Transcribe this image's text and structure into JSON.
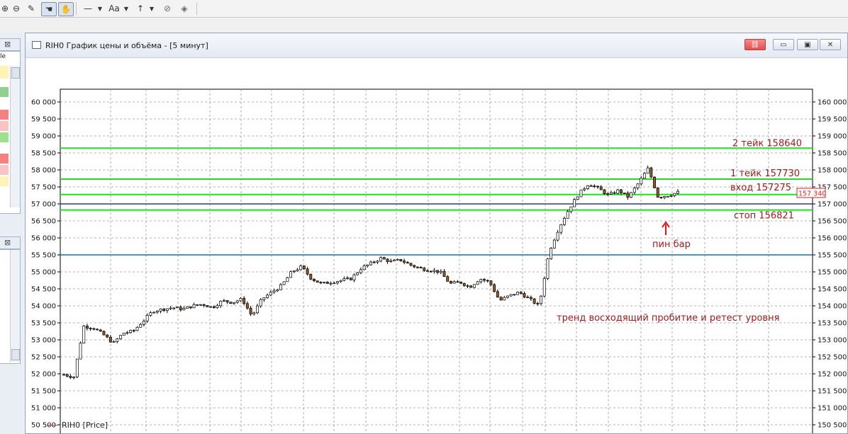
{
  "toolbar": {
    "font_label": "Aa"
  },
  "window": {
    "title": "RIH0 График цены и объёма - [5 минут]",
    "legend": "RIH0 [Price]"
  },
  "left_panel": {
    "label": "le"
  },
  "axis": {
    "left_ticks": [
      "60 000",
      "59 500",
      "59 000",
      "58 500",
      "58 000",
      "57 500",
      "57 000",
      "56 500",
      "56 000",
      "55 500",
      "55 000",
      "54 500",
      "54 000",
      "53 500",
      "53 000",
      "52 500",
      "52 000",
      "51 500",
      "51 000",
      "50 500",
      "50 000"
    ],
    "right_ticks": [
      "160 000",
      "159 500",
      "159 000",
      "158 500",
      "158 000",
      "157 500",
      "157 000",
      "156 500",
      "156 000",
      "155 500",
      "155 000",
      "154 500",
      "154 000",
      "153 500",
      "153 000",
      "152 500",
      "152 000",
      "151 500",
      "151 000",
      "150 500",
      "150 000"
    ],
    "current_price_label": "157 340"
  },
  "annotations": {
    "take2": "2 тейк 158640",
    "take1": "1 тейк 157730",
    "entry": "вход 157275",
    "stop": "стоп 156821",
    "pinbar": "пин бар",
    "trend": "тренд восходящий пробитие и ретест уровня"
  },
  "colors": {
    "green_level": "#22dd22",
    "blue_level": "#1f6fa8",
    "navy_level": "#283a8c",
    "annotation_text": "#a01c1c",
    "pinbar_arrow": "#ee1111",
    "bull_candle": "#ffffff",
    "bear_candle": "#8b5a2b",
    "current_price_box": "#d22222"
  },
  "chart_data": {
    "type": "candlestick",
    "instrument": "RIH0",
    "timeframe": "5 минут",
    "y_range": [
      150000,
      160000
    ],
    "levels": [
      {
        "label": "2 тейк 158640",
        "value": 158640,
        "color": "green"
      },
      {
        "label": "1 тейк 157730",
        "value": 157730,
        "color": "green"
      },
      {
        "label": "вход 157275",
        "value": 157275,
        "color": "green"
      },
      {
        "label": "",
        "value": 157000,
        "color": "navy"
      },
      {
        "label": "стоп 156821",
        "value": 156821,
        "color": "green"
      },
      {
        "label": "",
        "value": 155500,
        "color": "blue"
      }
    ],
    "close_path": [
      151980,
      151900,
      153400,
      153350,
      153150,
      152900,
      153200,
      153250,
      153550,
      153850,
      153900,
      153950,
      153900,
      154000,
      154050,
      153950,
      154150,
      154100,
      154200,
      153700,
      154200,
      154400,
      154600,
      155000,
      155150,
      154800,
      154650,
      154700,
      154750,
      154800,
      155100,
      155250,
      155400,
      155300,
      155350,
      155200,
      155100,
      155050,
      155000,
      154650,
      154700,
      154550,
      154800,
      154700,
      154150,
      154300,
      154400,
      154200,
      154000,
      155600,
      156300,
      156850,
      157300,
      157600,
      157450,
      157250,
      157400,
      157200,
      157600,
      158050,
      157200,
      157250,
      157340
    ]
  }
}
